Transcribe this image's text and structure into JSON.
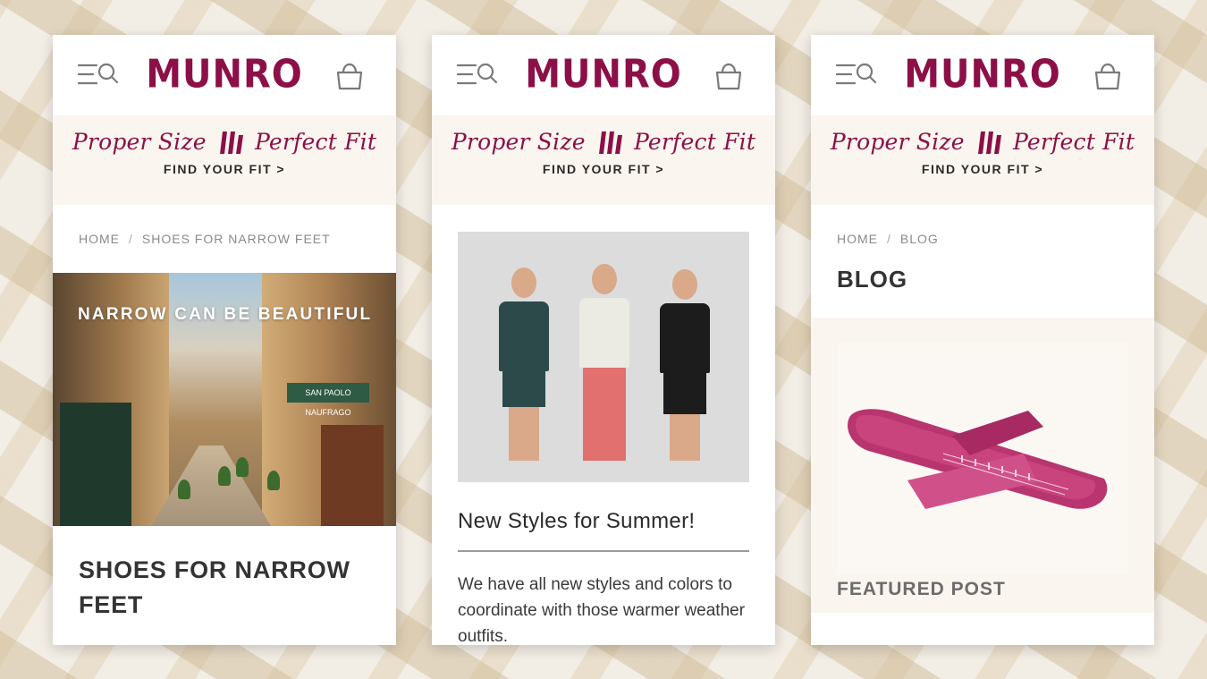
{
  "brand": {
    "logo": "MUNRO",
    "accent_color": "#8c1047",
    "promo_left": "Proper Size",
    "promo_right": "Perfect Fit",
    "promo_cta": "FIND YOUR FIT >"
  },
  "icons": {
    "menu": "menu-search-icon",
    "bag": "shopping-bag-icon",
    "mark": "munro-m-mark-icon"
  },
  "screens": [
    {
      "breadcrumb": [
        "HOME",
        "SHOES FOR NARROW FEET"
      ],
      "hero_caption": "NARROW CAN BE BEAUTIFUL",
      "hero_sign": "SAN PAOLO NAUFRAGO",
      "heading_line1": "SHOES FOR NARROW",
      "heading_line2": "FEET"
    },
    {
      "post_title": "New Styles for Summer!",
      "post_body": "We have all new styles and colors to coordinate with those warmer weather outfits."
    },
    {
      "breadcrumb": [
        "HOME",
        "BLOG"
      ],
      "heading": "BLOG",
      "featured_label": "FEATURED POST"
    }
  ]
}
